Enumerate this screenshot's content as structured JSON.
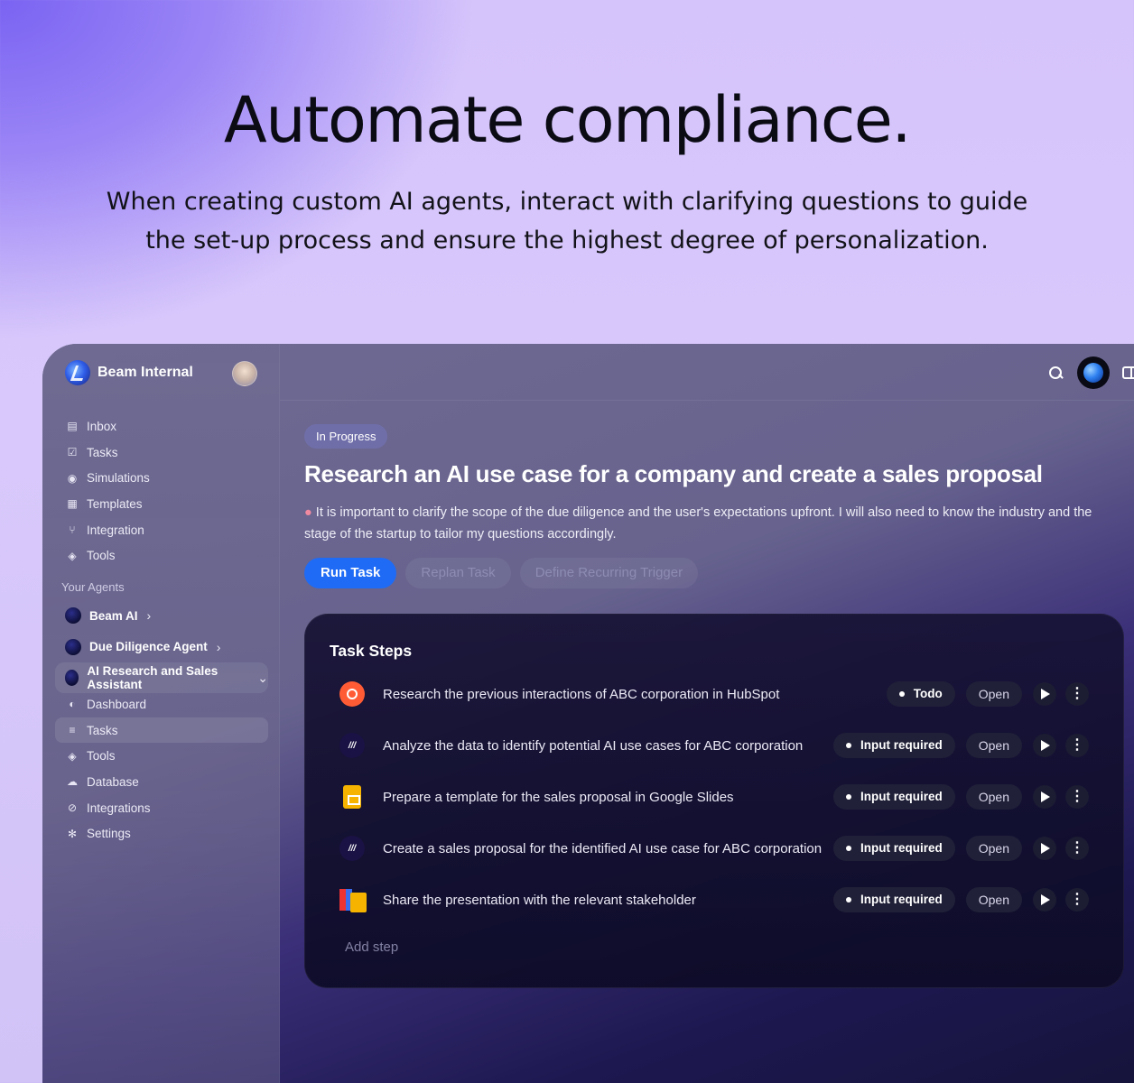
{
  "hero": {
    "title": "Automate compliance.",
    "subtitle": "When creating custom AI agents, interact with clarifying questions to guide the set-up process and ensure the highest degree of personalization."
  },
  "app": {
    "workspace_name": "Beam Internal",
    "nav": [
      {
        "label": "Inbox",
        "icon": "inbox-icon"
      },
      {
        "label": "Tasks",
        "icon": "tasks-icon"
      },
      {
        "label": "Simulations",
        "icon": "simulations-icon"
      },
      {
        "label": "Templates",
        "icon": "templates-icon"
      },
      {
        "label": "Integration",
        "icon": "integration-icon"
      },
      {
        "label": "Tools",
        "icon": "tools-icon"
      }
    ],
    "agents_section_label": "Your Agents",
    "agents": [
      {
        "label": "Beam AI",
        "chevron": "›"
      },
      {
        "label": "Due Diligence Agent",
        "chevron": "›"
      },
      {
        "label": "AI Research and Sales Assistant",
        "chevron": "⌄"
      }
    ],
    "agent_subnav": [
      {
        "label": "Dashboard",
        "icon": "dashboard-icon"
      },
      {
        "label": "Tasks",
        "icon": "tasks-icon"
      },
      {
        "label": "Tools",
        "icon": "tools-icon"
      },
      {
        "label": "Database",
        "icon": "database-icon"
      },
      {
        "label": "Integrations",
        "icon": "integrations-icon"
      },
      {
        "label": "Settings",
        "icon": "settings-icon"
      }
    ]
  },
  "task": {
    "status": "In Progress",
    "title": "Research an AI use case for a company and create a sales proposal",
    "description": "It is important to clarify the scope of the due diligence and the user's expectations upfront. I will also need to know the industry and the stage of the startup to tailor my questions accordingly.",
    "actions": {
      "run": "Run Task",
      "replan": "Replan Task",
      "trigger": "Define Recurring Trigger"
    }
  },
  "steps": {
    "title": "Task Steps",
    "open_label": "Open",
    "add_step": "Add step",
    "items": [
      {
        "label": "Research the previous interactions of ABC corporation in HubSpot",
        "status": "Todo",
        "app_icon": "hubspot-icon"
      },
      {
        "label": "Analyze the data to identify potential AI use cases for ABC corporation",
        "status": "Input required",
        "app_icon": "beam-agent-icon"
      },
      {
        "label": "Prepare a template for the sales proposal in Google Slides",
        "status": "Input required",
        "app_icon": "google-slides-icon"
      },
      {
        "label": "Create a sales proposal for the identified AI use case for ABC corporation",
        "status": "Input required",
        "app_icon": "beam-agent-icon"
      },
      {
        "label": "Share the presentation with the relevant stakeholder",
        "status": "Input required",
        "app_icon": "gmail-slides-icon"
      }
    ]
  },
  "colors": {
    "accent": "#1f6bf5",
    "hubspot": "#ff5c35",
    "slides": "#f6b400"
  }
}
